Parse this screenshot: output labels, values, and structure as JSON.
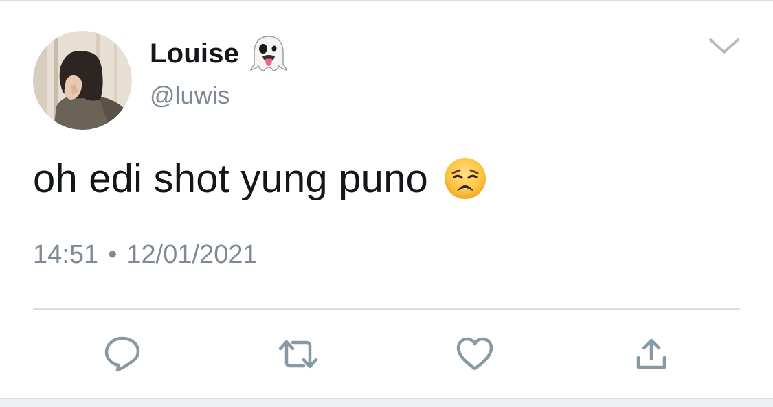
{
  "tweet": {
    "author": {
      "display_name": "Louise",
      "name_emoji": "ghost-icon",
      "handle": "@luwis",
      "avatar": "avatar"
    },
    "text": "oh edi shot yung puno",
    "text_emoji": "weary-face-icon",
    "time": "14:51",
    "separator": "•",
    "date": "12/01/2021"
  },
  "actions": [
    {
      "icon": "reply-icon"
    },
    {
      "icon": "retweet-icon"
    },
    {
      "icon": "like-icon"
    },
    {
      "icon": "share-icon"
    }
  ],
  "colors": {
    "text": "#14171a",
    "secondary": "#7f8a94",
    "icon": "#8899a6",
    "divider": "#d9dde1"
  }
}
